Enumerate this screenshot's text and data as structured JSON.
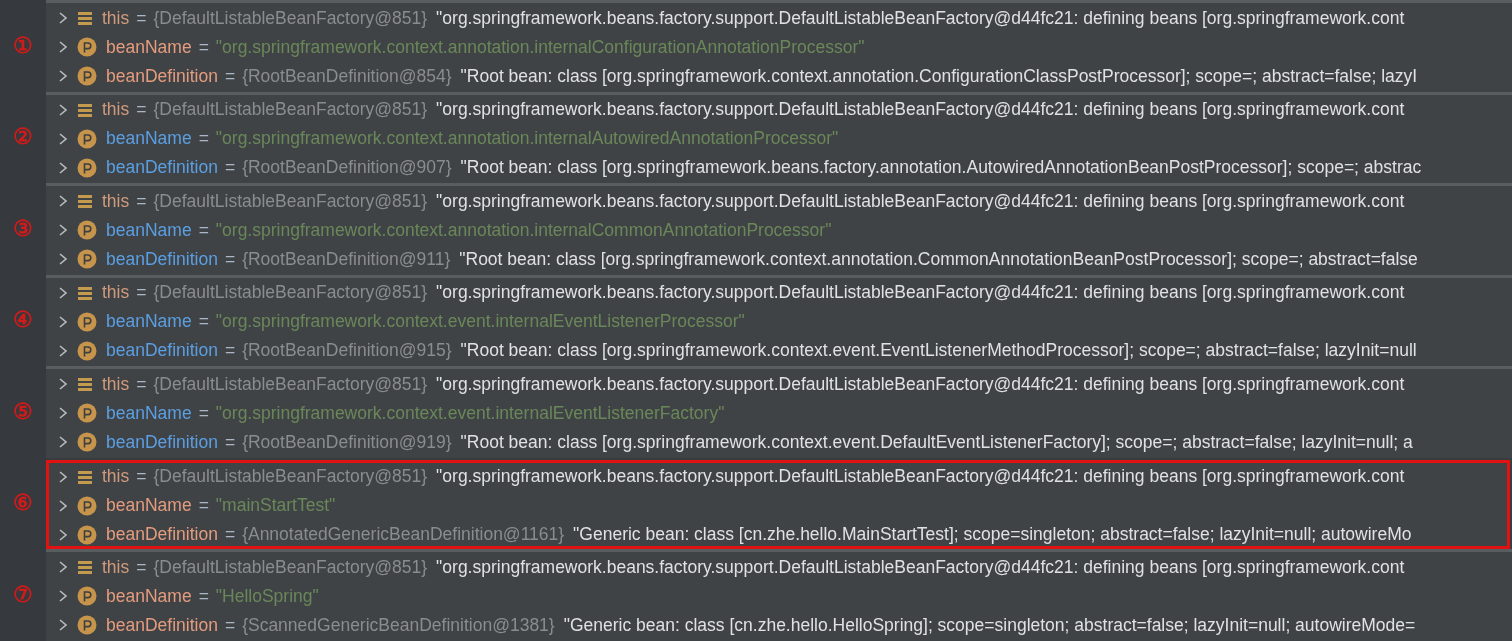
{
  "groups": [
    {
      "label": "①",
      "marked": false,
      "rows": [
        {
          "kind": "field",
          "name": "this",
          "color": "#d09a7c",
          "op": "=",
          "ref": "{DefaultListableBeanFactory@851}",
          "value": "\"org.springframework.beans.factory.support.DefaultListableBeanFactory@d44fc21: defining beans [org.springframework.cont",
          "is_string": false
        },
        {
          "kind": "param",
          "name": "beanName",
          "color": "#e49c7e",
          "op": "=",
          "value": "\"org.springframework.context.annotation.internalConfigurationAnnotationProcessor\"",
          "is_string": true
        },
        {
          "kind": "param",
          "name": "beanDefinition",
          "color": "#e49c7e",
          "op": "=",
          "ref": "{RootBeanDefinition@854}",
          "value": "\"Root bean: class [org.springframework.context.annotation.ConfigurationClassPostProcessor]; scope=; abstract=false; lazyI",
          "is_string": false
        }
      ]
    },
    {
      "label": "②",
      "marked": false,
      "rows": [
        {
          "kind": "field",
          "name": "this",
          "color": "#d09a7c",
          "op": "=",
          "ref": "{DefaultListableBeanFactory@851}",
          "value": "\"org.springframework.beans.factory.support.DefaultListableBeanFactory@d44fc21: defining beans [org.springframework.cont",
          "is_string": false
        },
        {
          "kind": "param",
          "name": "beanName",
          "color": "#5b9fe3",
          "op": "=",
          "value": "\"org.springframework.context.annotation.internalAutowiredAnnotationProcessor\"",
          "is_string": true
        },
        {
          "kind": "param",
          "name": "beanDefinition",
          "color": "#5b9fe3",
          "op": "=",
          "ref": "{RootBeanDefinition@907}",
          "value": "\"Root bean: class [org.springframework.beans.factory.annotation.AutowiredAnnotationBeanPostProcessor]; scope=; abstrac",
          "is_string": false
        }
      ]
    },
    {
      "label": "③",
      "marked": false,
      "rows": [
        {
          "kind": "field",
          "name": "this",
          "color": "#d09a7c",
          "op": "=",
          "ref": "{DefaultListableBeanFactory@851}",
          "value": "\"org.springframework.beans.factory.support.DefaultListableBeanFactory@d44fc21: defining beans [org.springframework.cont",
          "is_string": false
        },
        {
          "kind": "param",
          "name": "beanName",
          "color": "#5b9fe3",
          "op": "=",
          "value": "\"org.springframework.context.annotation.internalCommonAnnotationProcessor\"",
          "is_string": true
        },
        {
          "kind": "param",
          "name": "beanDefinition",
          "color": "#5b9fe3",
          "op": "=",
          "ref": "{RootBeanDefinition@911}",
          "value": "\"Root bean: class [org.springframework.context.annotation.CommonAnnotationBeanPostProcessor]; scope=; abstract=false",
          "is_string": false
        }
      ]
    },
    {
      "label": "④",
      "marked": false,
      "rows": [
        {
          "kind": "field",
          "name": "this",
          "color": "#d09a7c",
          "op": "=",
          "ref": "{DefaultListableBeanFactory@851}",
          "value": "\"org.springframework.beans.factory.support.DefaultListableBeanFactory@d44fc21: defining beans [org.springframework.cont",
          "is_string": false
        },
        {
          "kind": "param",
          "name": "beanName",
          "color": "#5b9fe3",
          "op": "=",
          "value": "\"org.springframework.context.event.internalEventListenerProcessor\"",
          "is_string": true
        },
        {
          "kind": "param",
          "name": "beanDefinition",
          "color": "#5b9fe3",
          "op": "=",
          "ref": "{RootBeanDefinition@915}",
          "value": "\"Root bean: class [org.springframework.context.event.EventListenerMethodProcessor]; scope=; abstract=false; lazyInit=null",
          "is_string": false
        }
      ]
    },
    {
      "label": "⑤",
      "marked": false,
      "rows": [
        {
          "kind": "field",
          "name": "this",
          "color": "#d09a7c",
          "op": "=",
          "ref": "{DefaultListableBeanFactory@851}",
          "value": "\"org.springframework.beans.factory.support.DefaultListableBeanFactory@d44fc21: defining beans [org.springframework.cont",
          "is_string": false
        },
        {
          "kind": "param",
          "name": "beanName",
          "color": "#5b9fe3",
          "op": "=",
          "value": "\"org.springframework.context.event.internalEventListenerFactory\"",
          "is_string": true
        },
        {
          "kind": "param",
          "name": "beanDefinition",
          "color": "#5b9fe3",
          "op": "=",
          "ref": "{RootBeanDefinition@919}",
          "value": "\"Root bean: class [org.springframework.context.event.DefaultEventListenerFactory]; scope=; abstract=false; lazyInit=null; a",
          "is_string": false
        }
      ]
    },
    {
      "label": "⑥",
      "marked": true,
      "rows": [
        {
          "kind": "field",
          "name": "this",
          "color": "#d09a7c",
          "op": "=",
          "ref": "{DefaultListableBeanFactory@851}",
          "value": "\"org.springframework.beans.factory.support.DefaultListableBeanFactory@d44fc21: defining beans [org.springframework.cont",
          "is_string": false
        },
        {
          "kind": "param",
          "name": "beanName",
          "color": "#e49c7e",
          "op": "=",
          "value": "\"mainStartTest\"",
          "is_string": true
        },
        {
          "kind": "param",
          "name": "beanDefinition",
          "color": "#e49c7e",
          "op": "=",
          "ref": "{AnnotatedGenericBeanDefinition@1161}",
          "value": "\"Generic bean: class [cn.zhe.hello.MainStartTest]; scope=singleton; abstract=false; lazyInit=null; autowireMo",
          "is_string": false
        }
      ]
    },
    {
      "label": "⑦",
      "marked": false,
      "rows": [
        {
          "kind": "field",
          "name": "this",
          "color": "#d09a7c",
          "op": "=",
          "ref": "{DefaultListableBeanFactory@851}",
          "value": "\"org.springframework.beans.factory.support.DefaultListableBeanFactory@d44fc21: defining beans [org.springframework.cont",
          "is_string": false
        },
        {
          "kind": "param",
          "name": "beanName",
          "color": "#e49c7e",
          "op": "=",
          "value": "\"HelloSpring\"",
          "is_string": true
        },
        {
          "kind": "param",
          "name": "beanDefinition",
          "color": "#e49c7e",
          "op": "=",
          "ref": "{ScannedGenericBeanDefinition@1381}",
          "value": "\"Generic bean: class [cn.zhe.hello.HelloSpring]; scope=singleton; abstract=false; lazyInit=null; autowireMode=",
          "is_string": false
        }
      ]
    }
  ]
}
